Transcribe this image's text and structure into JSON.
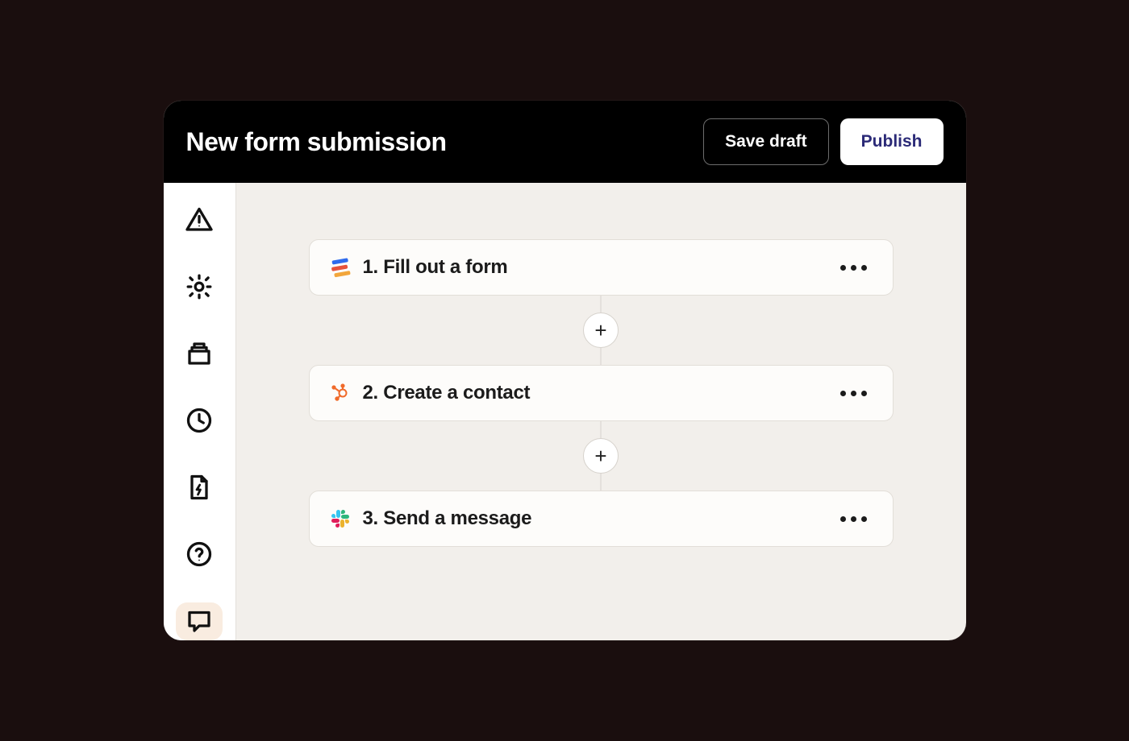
{
  "header": {
    "title": "New form submission",
    "save_draft_label": "Save draft",
    "publish_label": "Publish"
  },
  "sidebar": {
    "items": [
      {
        "name": "alerts",
        "icon": "alert-triangle-icon"
      },
      {
        "name": "settings",
        "icon": "gear-icon"
      },
      {
        "name": "stack",
        "icon": "stack-icon"
      },
      {
        "name": "history",
        "icon": "clock-icon"
      },
      {
        "name": "power",
        "icon": "file-bolt-icon"
      },
      {
        "name": "help",
        "icon": "help-circle-icon"
      },
      {
        "name": "comments",
        "icon": "comment-icon",
        "selected": true
      }
    ]
  },
  "flow": {
    "steps": [
      {
        "label": "1. Fill out a form",
        "app_icon": "todoist-logo"
      },
      {
        "label": "2. Create a contact",
        "app_icon": "hubspot-logo"
      },
      {
        "label": "3. Send a message",
        "app_icon": "slack-logo"
      }
    ],
    "add_label": "+"
  }
}
